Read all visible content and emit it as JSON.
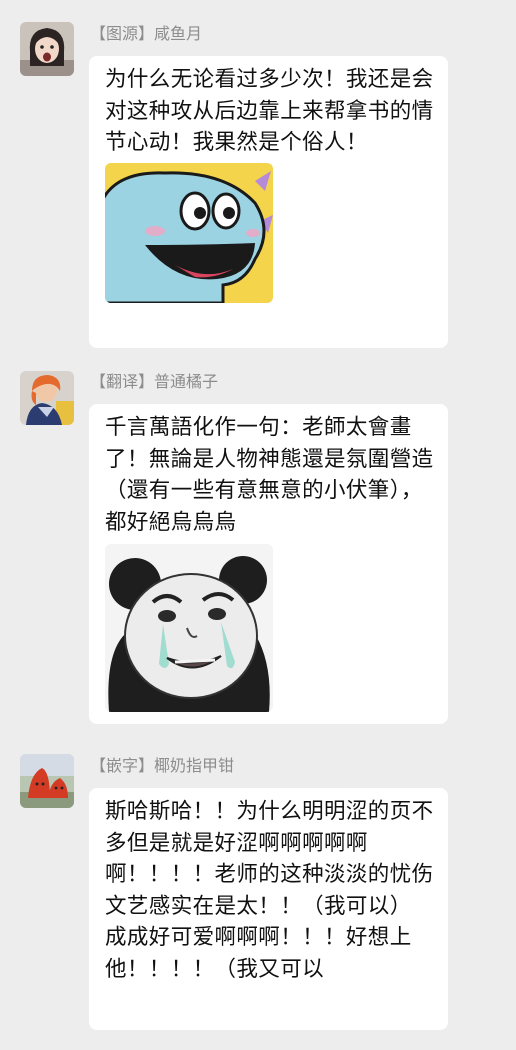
{
  "messages": [
    {
      "sender": "【图源】咸鱼月",
      "text": "为什么无论看过多少次！我还是会对这种攻从后边靠上来帮拿书的情节心动！我果然是个俗人！",
      "sticker": "blue-creature-sticker"
    },
    {
      "sender": "【翻译】普通橘子",
      "text": "千言萬語化作一句：老師太會畫了！無論是人物神態還是氛圍營造（還有一些有意無意的小伏筆），都好絕烏烏烏",
      "sticker": "crying-panda-sticker"
    },
    {
      "sender": "【嵌字】椰奶指甲钳",
      "text": "斯哈斯哈！！为什么明明涩的页不多但是就是好涩啊啊啊啊啊啊！！！！老师的这种淡淡的忧伤文艺感实在是太！！（我可以）　成成好可爱啊啊啊！！！好想上他！！！！（我又可以"
    }
  ]
}
